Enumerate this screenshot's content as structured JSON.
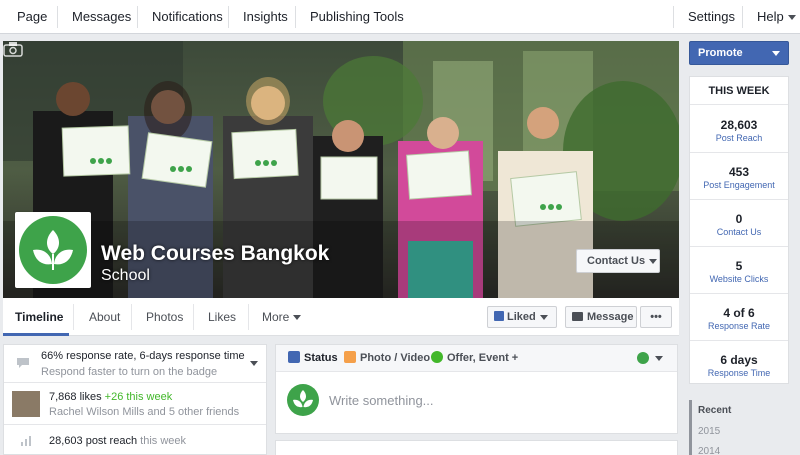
{
  "topbar": {
    "tabs": [
      "Page",
      "Messages",
      "Notifications",
      "Insights",
      "Publishing Tools"
    ],
    "settings": "Settings",
    "help": "Help"
  },
  "cover": {
    "page_name": "Web Courses Bangkok",
    "category": "School",
    "contact_button": "Contact Us"
  },
  "page_nav": {
    "tabs": [
      "Timeline",
      "About",
      "Photos",
      "Likes",
      "More"
    ],
    "liked": "Liked",
    "message": "Message",
    "options": "•••"
  },
  "left_column": {
    "response_rate": "66% response rate, 6-days response time",
    "response_hint": "Respond faster to turn on the badge",
    "likes": "7,868 likes",
    "likes_delta": "+26 this week",
    "friends": "Rachel Wilson Mills and 5 other friends",
    "reach": "28,603 post reach",
    "reach_period": "this week"
  },
  "composer": {
    "tabs": [
      "Status",
      "Photo / Video",
      "Offer, Event +"
    ],
    "placeholder": "Write something..."
  },
  "right_column": {
    "promote": "Promote",
    "week_title": "THIS WEEK",
    "stats": [
      {
        "value": "28,603",
        "label": "Post Reach"
      },
      {
        "value": "453",
        "label": "Post Engagement"
      },
      {
        "value": "0",
        "label": "Contact Us"
      },
      {
        "value": "5",
        "label": "Website Clicks"
      },
      {
        "value": "4 of 6",
        "label": "Response Rate"
      },
      {
        "value": "6 days",
        "label": "Response Time"
      }
    ],
    "years": [
      "Recent",
      "2015",
      "2014"
    ]
  },
  "colors": {
    "brand_blue": "#4267b2",
    "logo_green": "#3ea34a",
    "page_bg": "#e9ebee"
  }
}
